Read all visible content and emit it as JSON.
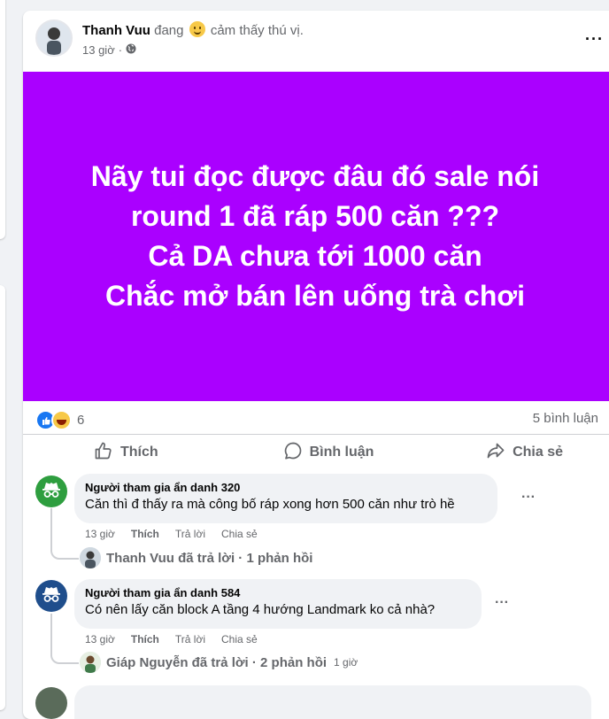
{
  "post": {
    "author": "Thanh Vuu",
    "feeling_prefix": "đang",
    "feeling_text": "cảm thấy thú vị.",
    "time": "13 giờ",
    "dot": "·",
    "more": "···",
    "banner_color": "#aa00ff",
    "banner_lines": [
      "Nãy tui đọc được đâu đó sale nói",
      "round 1 đã ráp 500 căn ???",
      "Cả DA chưa tới 1000 căn",
      "Chắc mở bán lên uống trà chơi"
    ],
    "reaction_count": "6",
    "comments_count": "5 bình luận"
  },
  "actions": {
    "like": "Thích",
    "comment": "Bình luận",
    "share": "Chia sẻ"
  },
  "comments": [
    {
      "name": "Người tham gia ẩn danh 320",
      "text": "Căn thì đ thấy ra mà công bố ráp xong hơn 500 căn như trò hề",
      "time": "13 giờ",
      "like": "Thích",
      "reply": "Trả lời",
      "share": "Chia sẻ",
      "replies_summary": "Thanh Vuu đã trả lời · 1 phản hồi",
      "replies_time": "",
      "more": "···",
      "avatar_color": "#2e9e3f"
    },
    {
      "name": "Người tham gia ẩn danh 584",
      "text": "Có nên lấy căn block A tầng 4 hướng Landmark ko cả nhà?",
      "time": "13 giờ",
      "like": "Thích",
      "reply": "Trả lời",
      "share": "Chia sẻ",
      "replies_summary": "Giáp Nguyễn đã trả lời · 2 phản hồi",
      "replies_time": "1 giờ",
      "more": "···",
      "avatar_color": "#1f4e8c"
    }
  ]
}
